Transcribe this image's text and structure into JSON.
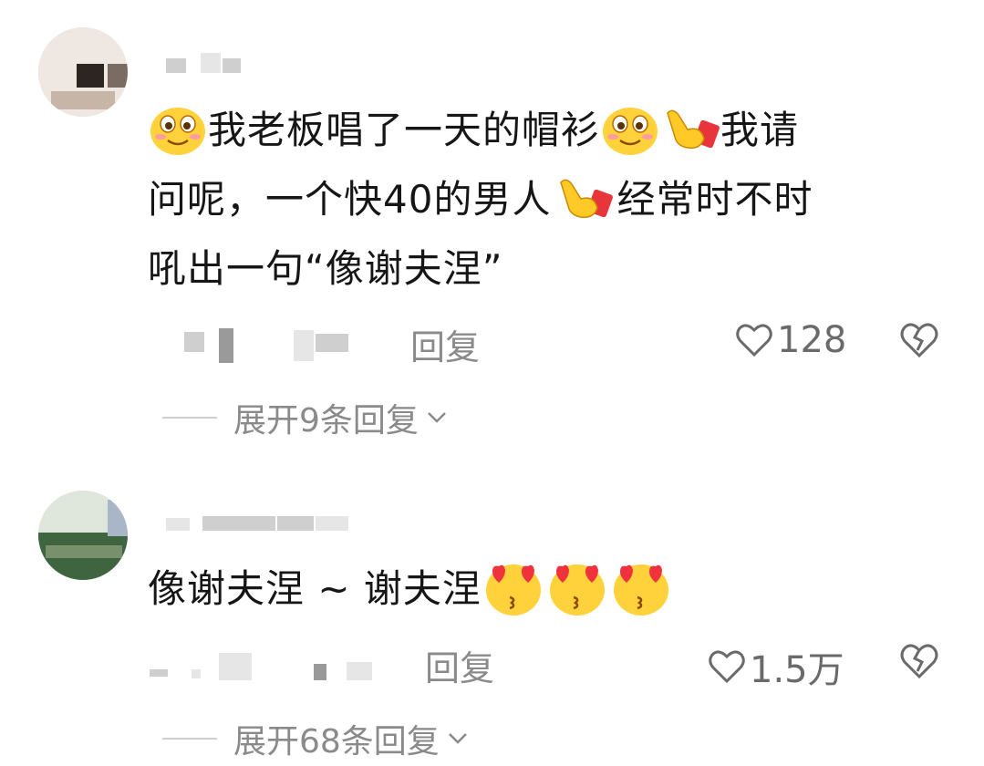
{
  "comments": [
    {
      "text": {
        "part1": "我老板唱了一天的帽衫",
        "part2": "我请",
        "part3": "问呢，一个快40的男人",
        "part4": "经常时不时",
        "part5": "吼出一句“像谢夫涅”"
      },
      "reply_label": "回复",
      "likes": "128",
      "expand_label": "展开9条回复"
    },
    {
      "text": {
        "part1": "像谢夫涅 ~ 谢夫涅"
      },
      "reply_label": "回复",
      "likes": "1.5万",
      "expand_label": "展开68条回复"
    }
  ]
}
